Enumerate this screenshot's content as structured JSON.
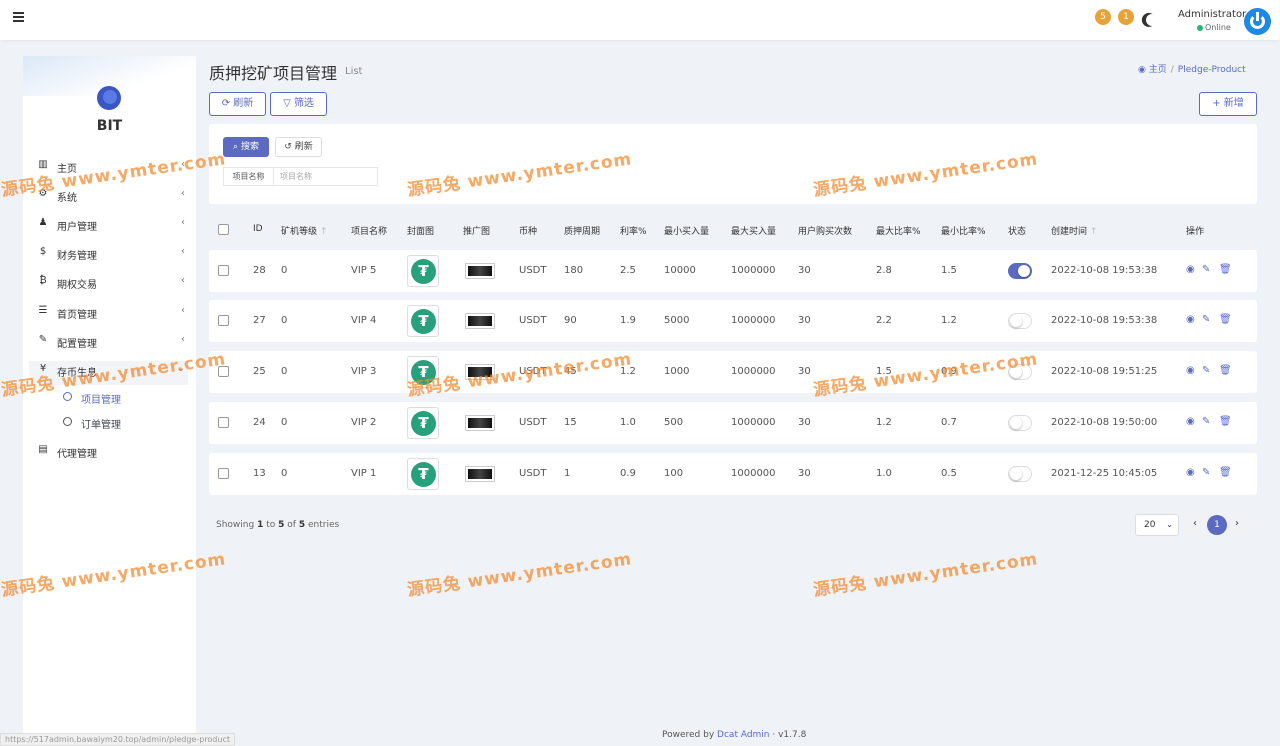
{
  "header": {
    "badge1": "5",
    "badge2": "1",
    "admin_name": "Administrator",
    "admin_status": "Online"
  },
  "sidebar": {
    "logo_text": "BIT",
    "items": [
      {
        "label": "主页",
        "icon": "bar-chart-icon",
        "glyph": "▥"
      },
      {
        "label": "系统",
        "icon": "gear-icon",
        "glyph": "⚙"
      },
      {
        "label": "用户管理",
        "icon": "users-icon",
        "glyph": "♟"
      },
      {
        "label": "财务管理",
        "icon": "dollar-icon",
        "glyph": "$"
      },
      {
        "label": "期权交易",
        "icon": "bitcoin-icon",
        "glyph": "₿"
      },
      {
        "label": "首页管理",
        "icon": "list-icon",
        "glyph": "☰"
      },
      {
        "label": "配置管理",
        "icon": "wrench-icon",
        "glyph": "✎"
      },
      {
        "label": "存币生息",
        "icon": "yen-icon",
        "glyph": "¥"
      }
    ],
    "sub_items": [
      "项目管理",
      "订单管理"
    ],
    "agent_label": "代理管理"
  },
  "page": {
    "title": "质押挖矿项目管理",
    "subtitle": "List",
    "breadcrumb_home": "主页",
    "breadcrumb_current": "Pledge-Product",
    "refresh_label": "刷新",
    "filter_label": "筛选",
    "new_label": "新增"
  },
  "filter": {
    "search_label": "搜索",
    "reset_label": "刷新",
    "field_label": "项目名称",
    "field_placeholder": "项目名称"
  },
  "table": {
    "columns": [
      "ID",
      "矿机等级",
      "项目名称",
      "封面图",
      "推广图",
      "币种",
      "质押周期",
      "利率%",
      "最小买入量",
      "最大买入量",
      "用户购买次数",
      "最大比率%",
      "最小比率%",
      "状态",
      "创建时间",
      "操作"
    ],
    "rows": [
      {
        "id": "28",
        "level": "0",
        "name": "VIP 5",
        "coin": "USDT",
        "cycle": "180",
        "rate": "2.5",
        "min_buy": "10000",
        "max_buy": "1000000",
        "times": "30",
        "max_ratio": "2.8",
        "min_ratio": "1.5",
        "status": true,
        "created": "2022-10-08 19:53:38"
      },
      {
        "id": "27",
        "level": "0",
        "name": "VIP 4",
        "coin": "USDT",
        "cycle": "90",
        "rate": "1.9",
        "min_buy": "5000",
        "max_buy": "1000000",
        "times": "30",
        "max_ratio": "2.2",
        "min_ratio": "1.2",
        "status": false,
        "created": "2022-10-08 19:53:38"
      },
      {
        "id": "25",
        "level": "0",
        "name": "VIP 3",
        "coin": "USDT",
        "cycle": "45",
        "rate": "1.2",
        "min_buy": "1000",
        "max_buy": "1000000",
        "times": "30",
        "max_ratio": "1.5",
        "min_ratio": "0.9",
        "status": false,
        "created": "2022-10-08 19:51:25"
      },
      {
        "id": "24",
        "level": "0",
        "name": "VIP 2",
        "coin": "USDT",
        "cycle": "15",
        "rate": "1.0",
        "min_buy": "500",
        "max_buy": "1000000",
        "times": "30",
        "max_ratio": "1.2",
        "min_ratio": "0.7",
        "status": false,
        "created": "2022-10-08 19:50:00"
      },
      {
        "id": "13",
        "level": "0",
        "name": "VIP 1",
        "coin": "USDT",
        "cycle": "1",
        "rate": "0.9",
        "min_buy": "100",
        "max_buy": "1000000",
        "times": "30",
        "max_ratio": "1.0",
        "min_ratio": "0.5",
        "status": false,
        "created": "2021-12-25 10:45:05"
      }
    ]
  },
  "pagination": {
    "showing_prefix": "Showing",
    "from": "1",
    "to_word": "to",
    "to": "5",
    "of_word": "of",
    "total": "5",
    "entries_word": "entries",
    "per_page": "20",
    "current_page": "1"
  },
  "footer": {
    "powered": "Powered by",
    "brand": "Dcat Admin",
    "version": "v1.7.8"
  },
  "status_url": "https://517admin.bawaiym20.top/admin/pledge-product",
  "watermark": "源码兔 www.ymter.com",
  "colors": {
    "primary": "#5c6bc0",
    "usdt": "#26a17b",
    "badge": "#e8a238"
  }
}
